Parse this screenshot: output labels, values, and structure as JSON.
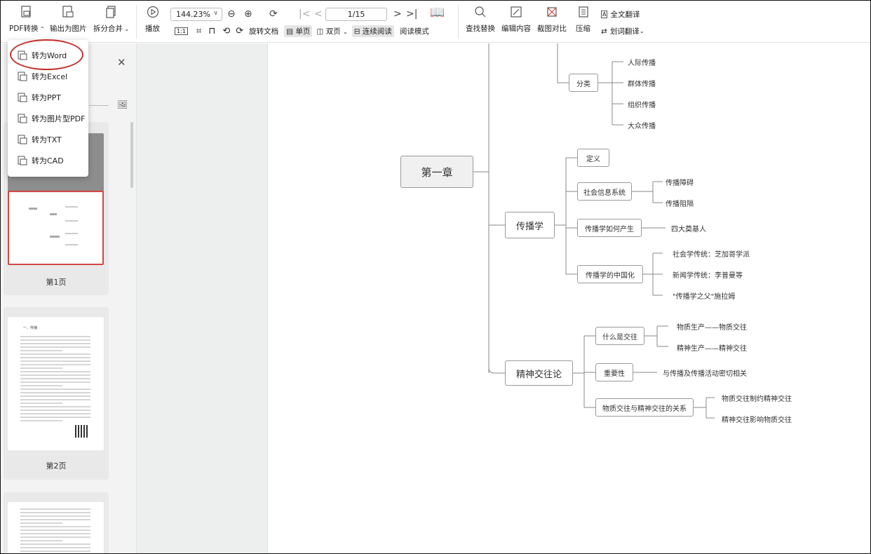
{
  "toolbar": {
    "pdf_convert": "PDF转换",
    "export_image": "输出为图片",
    "split_merge": "拆分合并",
    "play": "播放",
    "zoom": "144.23%",
    "rotate_doc": "旋转文档",
    "single_page": "单页",
    "double_page": "双页",
    "continuous": "连续阅读",
    "read_mode": "阅读模式",
    "page_indicator": "1/15",
    "find_replace": "查找替换",
    "edit_content": "编辑内容",
    "screenshot_compare": "截图对比",
    "compress": "压缩",
    "full_translate": "全文翻译",
    "word_translate": "划词翻译"
  },
  "dropdown": {
    "items": [
      "转为Word",
      "转为Excel",
      "转为PPT",
      "转为图片型PDF",
      "转为TXT",
      "转为CAD"
    ]
  },
  "thumbnails": {
    "labels": [
      "第1页",
      "第2页"
    ],
    "page2_heading": "一、传播"
  },
  "mindmap": {
    "root": "第一章",
    "branch1": "传播学",
    "branch2": "精神交往论",
    "fenlei": "分类",
    "fenlei_items": [
      "人际传播",
      "群体传播",
      "组织传播",
      "大众传播"
    ],
    "dingyi": "定义",
    "shehui": "社会信息系统",
    "shehui_items": [
      "传播障碍",
      "传播阻隔"
    ],
    "ruhe": "传播学如何产生",
    "ruhe_item": "四大奠基人",
    "zhongguo": "传播学的中国化",
    "zhongguo_items": [
      "社会学传统：芝加哥学派",
      "新闻学传统：李普曼等",
      "\"传播学之父\"施拉姆"
    ],
    "jiaowang": "什么是交往",
    "jiaowang_items": [
      "物质生产——物质交往",
      "精神生产——精神交往"
    ],
    "zhongyao": "重要性",
    "zhongyao_item": "与传播及传播活动密切相关",
    "guanxi": "物质交往与精神交往的关系",
    "guanxi_items": [
      "物质交往制约精神交往",
      "精神交往影响物质交往"
    ]
  }
}
